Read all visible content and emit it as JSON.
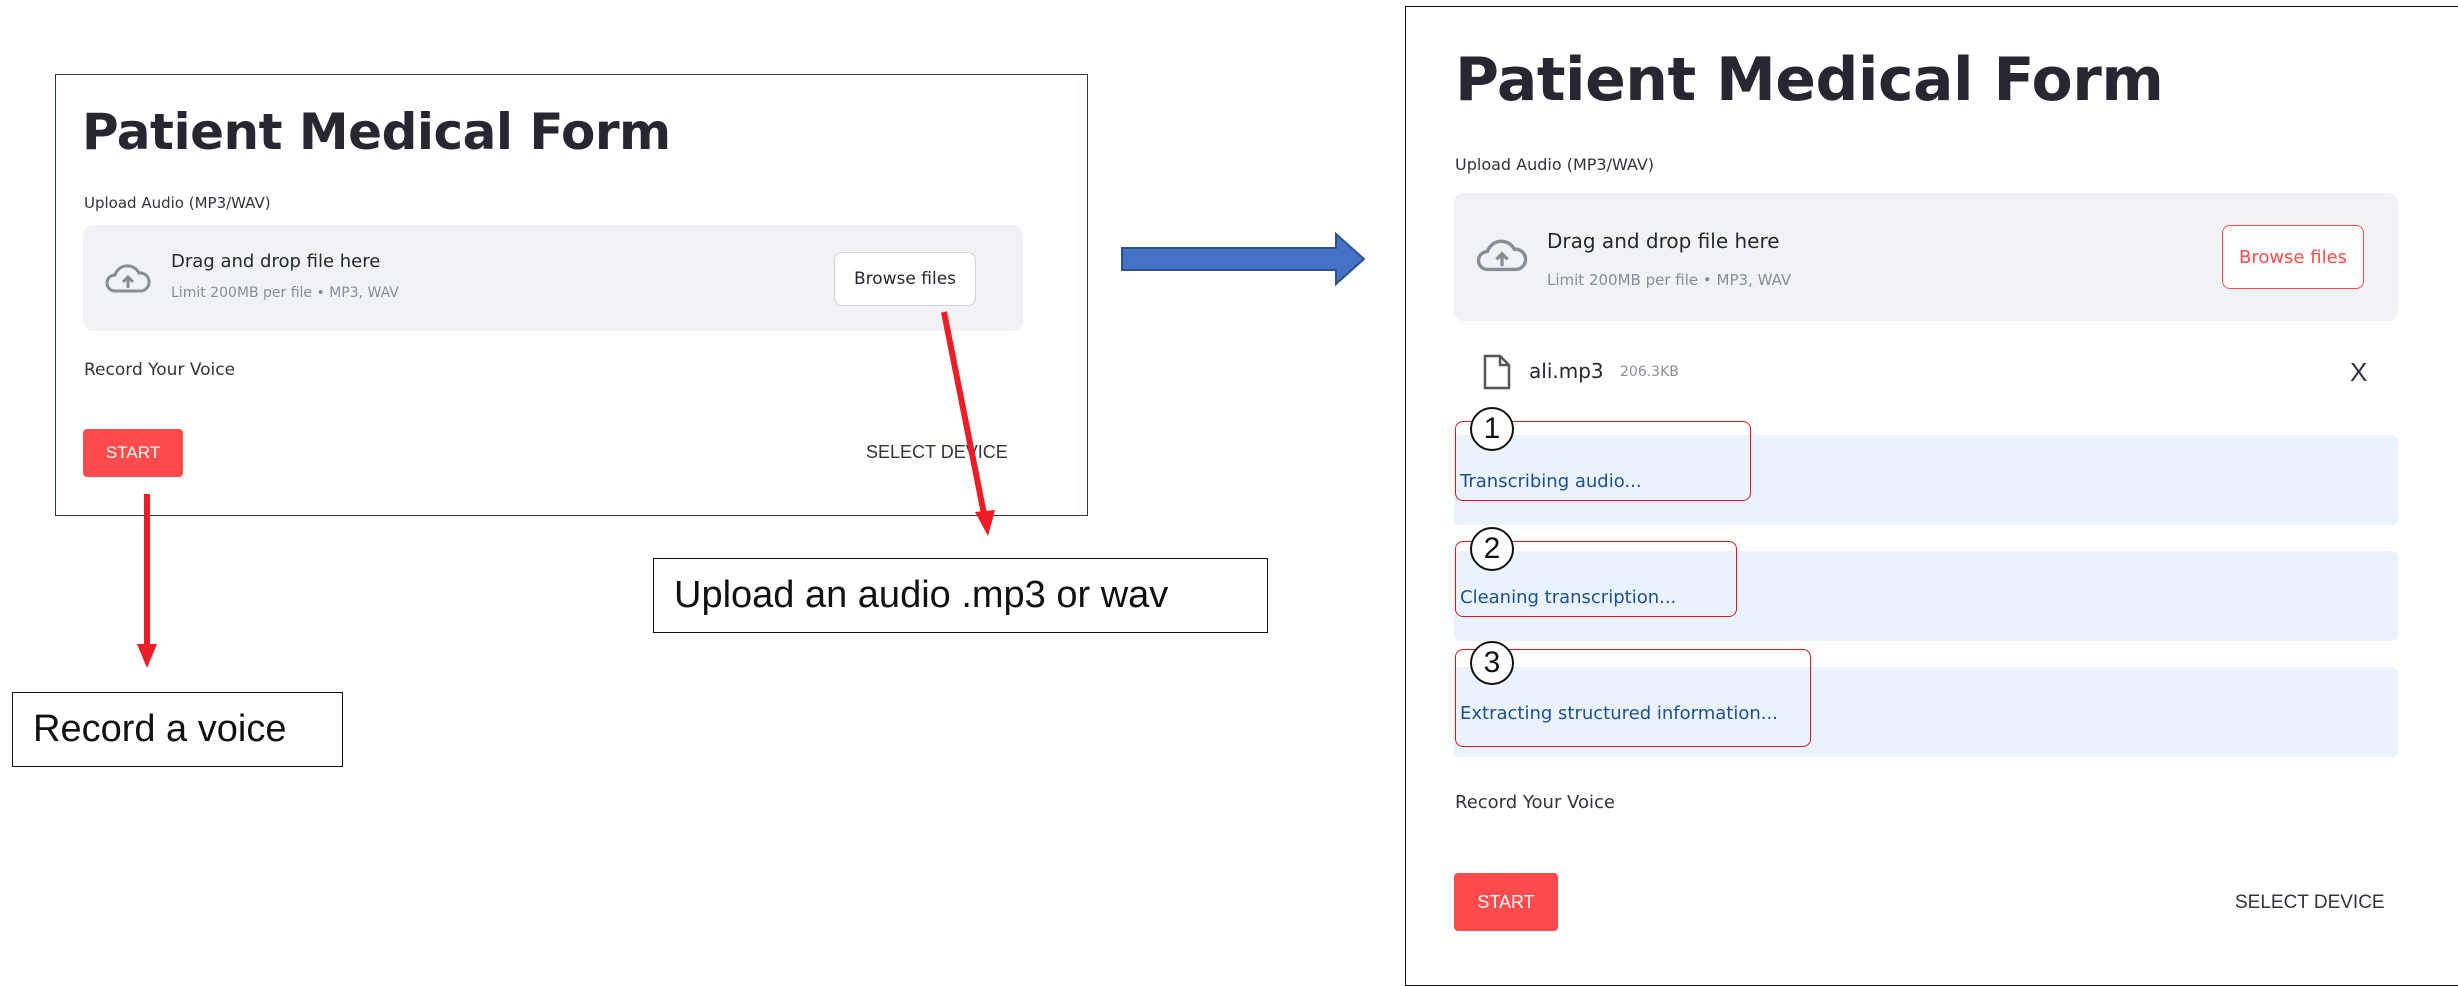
{
  "left_form": {
    "title": "Patient Medical Form",
    "upload_label": "Upload Audio (MP3/WAV)",
    "dropzone_title": "Drag and drop file here",
    "dropzone_sub": "Limit 200MB per file • MP3, WAV",
    "browse_label": "Browse files",
    "record_label": "Record Your Voice",
    "start_label": "START",
    "select_device_label": "SELECT DEVICE"
  },
  "right_form": {
    "title": "Patient Medical Form",
    "upload_label": "Upload Audio (MP3/WAV)",
    "dropzone_title": "Drag and drop file here",
    "dropzone_sub": "Limit 200MB per file • MP3, WAV",
    "browse_label": "Browse files",
    "file": {
      "name": "ali.mp3",
      "size": "206.3KB",
      "remove": "X"
    },
    "steps": [
      {
        "number": "1",
        "text": "Transcribing audio..."
      },
      {
        "number": "2",
        "text": "Cleaning transcription..."
      },
      {
        "number": "3",
        "text": "Extracting structured information..."
      }
    ],
    "record_label": "Record Your Voice",
    "start_label": "START",
    "select_device_label": "SELECT DEVICE"
  },
  "annotations": {
    "upload_note": "Upload an audio .mp3 or wav",
    "record_note": "Record a voice"
  },
  "colors": {
    "accent_red": "#ff4b4b",
    "arrow_red": "#ee1c25",
    "flow_arrow_blue": "#4472c4",
    "status_bg": "#eaf3fc",
    "dropzone_bg": "#f0f2f6"
  },
  "icons": [
    "cloud-upload-icon",
    "file-icon",
    "close-icon"
  ]
}
